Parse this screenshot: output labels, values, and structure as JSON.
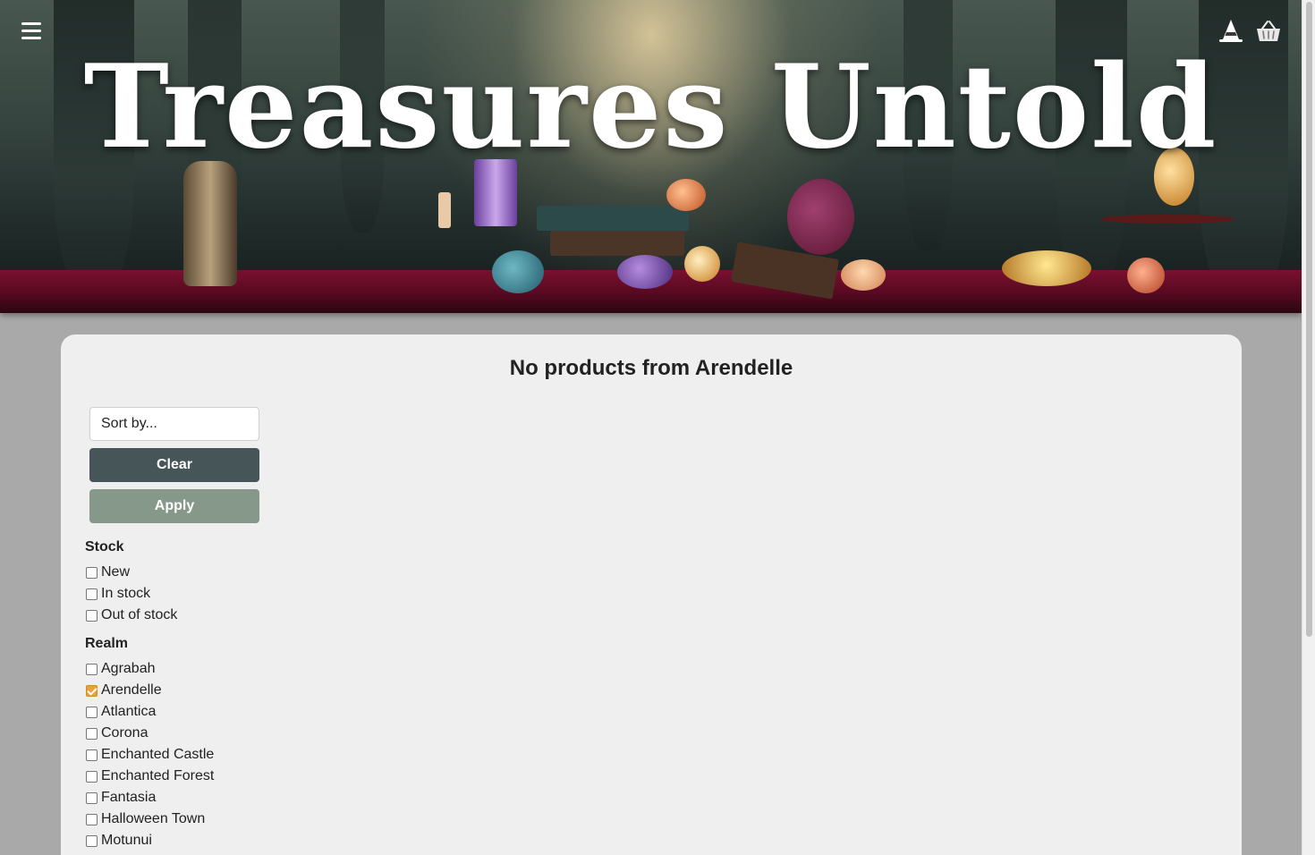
{
  "header": {
    "title": "Treasures Untold",
    "menu_icon": "hamburger-menu-icon",
    "account_icon": "witch-hat-icon",
    "cart_icon": "basket-icon"
  },
  "main": {
    "heading": "No products from Arendelle",
    "sort_placeholder": "Sort by...",
    "clear_label": "Clear",
    "apply_label": "Apply"
  },
  "filters": {
    "stock": {
      "title": "Stock",
      "options": [
        {
          "label": "New",
          "checked": false
        },
        {
          "label": "In stock",
          "checked": false
        },
        {
          "label": "Out of stock",
          "checked": false
        }
      ]
    },
    "realm": {
      "title": "Realm",
      "options": [
        {
          "label": "Agrabah",
          "checked": false
        },
        {
          "label": "Arendelle",
          "checked": true
        },
        {
          "label": "Atlantica",
          "checked": false
        },
        {
          "label": "Corona",
          "checked": false
        },
        {
          "label": "Enchanted Castle",
          "checked": false
        },
        {
          "label": "Enchanted Forest",
          "checked": false
        },
        {
          "label": "Fantasia",
          "checked": false
        },
        {
          "label": "Halloween Town",
          "checked": false
        },
        {
          "label": "Motunui",
          "checked": false
        }
      ]
    }
  },
  "colors": {
    "clear_button": "#455558",
    "apply_button": "#86988a",
    "checked_accent": "#e9a23b"
  }
}
